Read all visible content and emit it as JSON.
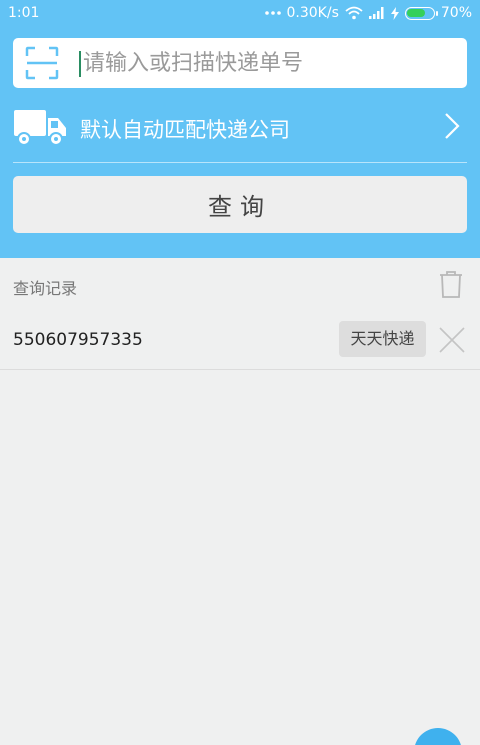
{
  "status_bar": {
    "time": "1:01",
    "network_speed": "0.30K/s",
    "battery": "70%",
    "battery_level": 0.7,
    "battery_color": "#35d05a"
  },
  "search": {
    "placeholder": "请输入或扫描快递单号",
    "value": "",
    "scan_icon": "scan-icon"
  },
  "company": {
    "label": "默认自动匹配快递公司",
    "truck_icon": "truck-icon",
    "chevron_icon": "chevron-right-icon"
  },
  "query_button": {
    "label": "查询"
  },
  "history": {
    "title": "查询记录",
    "trash_icon": "trash-icon",
    "items": [
      {
        "number": "550607957335",
        "courier": "天天快递"
      }
    ]
  },
  "colors": {
    "header": "#62c3f5",
    "background": "#eff0f0",
    "fab": "#3fb1ee"
  }
}
